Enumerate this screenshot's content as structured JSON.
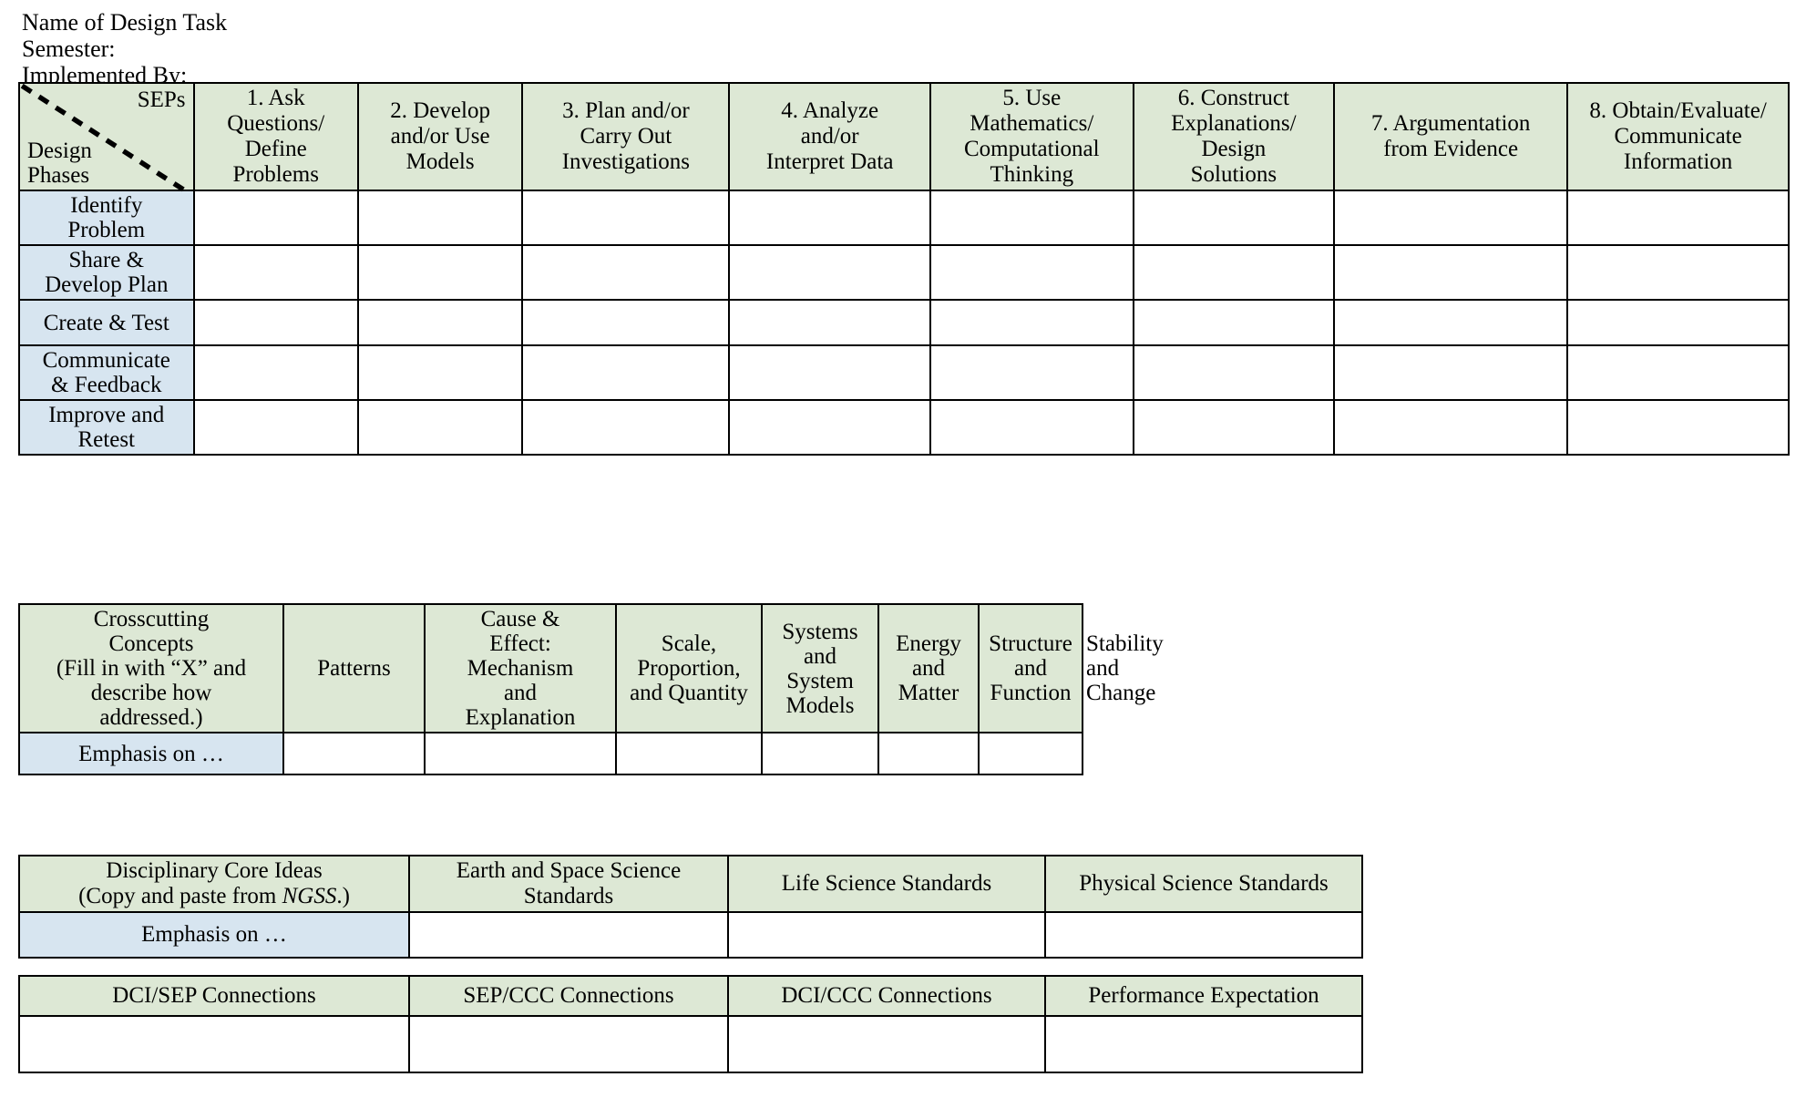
{
  "document": {
    "heading_lines": [
      "Name of Design Task",
      "Semester:",
      "Implemented By:"
    ]
  },
  "colors": {
    "header_green": "#dde8d5",
    "row_label_blue": "#d7e5f0",
    "border": "#000000",
    "page_background": "#ffffff"
  },
  "sep_table": {
    "corner": {
      "top_right_label": "SEPs",
      "bottom_left_label_line1": "Design",
      "bottom_left_label_line2": "Phases",
      "divider": "dashed-diagonal"
    },
    "columns": [
      "1. Ask Questions/ Define Problems",
      "2. Develop and/or Use Models",
      "3. Plan and/or Carry Out Investigations",
      "4. Analyze and/or Interpret Data",
      "5. Use Mathematics/ Computational Thinking",
      "6. Construct Explanations/ Design Solutions",
      "7. Argumentation from Evidence",
      "8. Obtain/Evaluate/ Communicate Information"
    ],
    "column_lines": [
      [
        "1. Ask",
        "Questions/",
        "Define",
        "Problems"
      ],
      [
        "2. Develop",
        "and/or Use",
        "Models"
      ],
      [
        "3. Plan and/or",
        "Carry Out",
        "Investigations"
      ],
      [
        "4. Analyze",
        "and/or",
        "Interpret Data"
      ],
      [
        "5. Use",
        "Mathematics/",
        "Computational",
        "Thinking"
      ],
      [
        "6. Construct",
        "Explanations/",
        "Design",
        "Solutions"
      ],
      [
        "7. Argumentation",
        "from Evidence"
      ],
      [
        "8. Obtain/Evaluate/",
        "Communicate",
        "Information"
      ]
    ],
    "rows": [
      {
        "label": "Identify Problem",
        "lines": [
          "Identify",
          "Problem"
        ]
      },
      {
        "label": "Share & Develop Plan",
        "lines": [
          "Share &",
          "Develop Plan"
        ]
      },
      {
        "label": "Create & Test",
        "lines": [
          "Create & Test"
        ]
      },
      {
        "label": "Communicate & Feedback",
        "lines": [
          "Communicate",
          "& Feedback"
        ]
      },
      {
        "label": "Improve and Retest",
        "lines": [
          "Improve and",
          "Retest"
        ]
      }
    ]
  },
  "ccc_table": {
    "header_label_lines": [
      "Crosscutting",
      "Concepts",
      "(Fill in with “X” and",
      "describe how",
      "addressed.)"
    ],
    "header_label": "Crosscutting Concepts (Fill in with “X” and describe how addressed.)",
    "columns": [
      "Patterns",
      "Cause & Effect: Mechanism and Explanation",
      "Scale, Proportion, and Quantity",
      "Systems and System Models",
      "Energy and Matter",
      "Structure and Function",
      "Stability and Change"
    ],
    "column_lines": [
      [
        "Patterns"
      ],
      [
        "Cause &",
        "Effect:",
        "Mechanism",
        "and",
        "Explanation"
      ],
      [
        "Scale,",
        "Proportion,",
        "and Quantity"
      ],
      [
        "Systems",
        "and",
        "System",
        "Models"
      ],
      [
        "Energy",
        "and",
        "Matter"
      ],
      [
        "Structure",
        "and",
        "Function"
      ],
      [
        "Stability",
        "and",
        "Change"
      ]
    ],
    "row_label": "Emphasis on …"
  },
  "dci_table": {
    "header_label_line1": "Disciplinary Core Ideas",
    "header_label_line2_pre": "(Copy and paste from ",
    "header_label_line2_italic": "NGSS",
    "header_label_line2_post": ".)",
    "header_label": "Disciplinary Core Ideas (Copy and paste from NGSS.)",
    "columns": [
      "Earth and Space Science Standards",
      "Life Science Standards",
      "Physical Science Standards"
    ],
    "row_label": "Emphasis on …"
  },
  "connections_table": {
    "columns": [
      "DCI/SEP Connections",
      "SEP/CCC Connections",
      "DCI/CCC Connections",
      "Performance Expectation"
    ]
  }
}
